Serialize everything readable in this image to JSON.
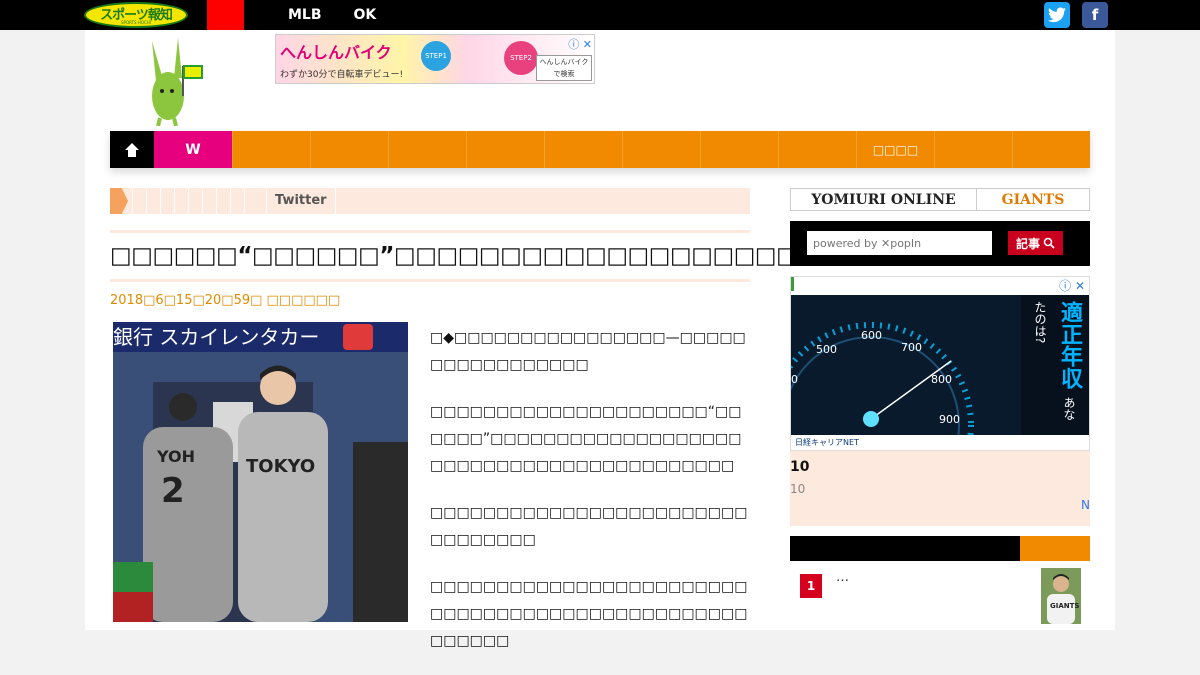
{
  "header": {
    "logo_text": "スポーツ報知",
    "logo_sub": "SPORTS HOCHI",
    "nav_items": [
      "MLB",
      "OK"
    ],
    "social": [
      "twitter",
      "facebook"
    ]
  },
  "ad_banner": {
    "brand": "へんしんバイク",
    "sub": "わずか30分で自転車デビュー!",
    "step1": "STEP1",
    "step2": "STEP2",
    "side_text": "へんしんバイク で検索"
  },
  "main_nav": {
    "home_icon": "home-icon",
    "w_label": "W",
    "cells": [
      "",
      "",
      "",
      "",
      "",
      "",
      "",
      "",
      "□□□□",
      "",
      ""
    ]
  },
  "breadcrumb": {
    "tag": "Twitter"
  },
  "article": {
    "title": "□□□□□□“□□□□□□”□□□□□□□□□□□□□□□□□□□□□□□□□□□",
    "date": "2018□6□15□20□59□  □□□□□□",
    "paragraphs": [
      "□◆□□□□□□□□□□□□□□□□—□□□□□□□□□□□□□□□□□",
      "□□□□□□□□□□□□□□□□□□□□□“□□□□□□”□□□□□□□□□□□□□□□□□□□□□□□□□□□□□□□□□□□□□□□□□□",
      "□□□□□□□□□□□□□□□□□□□□□□□□□□□□□□□□",
      "□□□□□□□□□□□□□□□□□□□□□□□□□□□□□□□□□□□□□□□□□□□□□□□□□□□□□□"
    ]
  },
  "sidebar": {
    "yomiuri": "YOMIURI ONLINE",
    "giants": "GIANTS",
    "search_placeholder": "powered by ✕popIn",
    "search_button": "記事",
    "ad2_vertical": "適正年収",
    "ad2_vertical_small": "あなたのは?",
    "ad2_footer": "日経キャリアNET",
    "gauge_labels": [
      "500",
      "600",
      "700",
      "800",
      "900",
      "0"
    ],
    "box_line1": "10",
    "box_line2": "10",
    "box_more": "N",
    "rank_number": "1",
    "rank_text": "…"
  }
}
